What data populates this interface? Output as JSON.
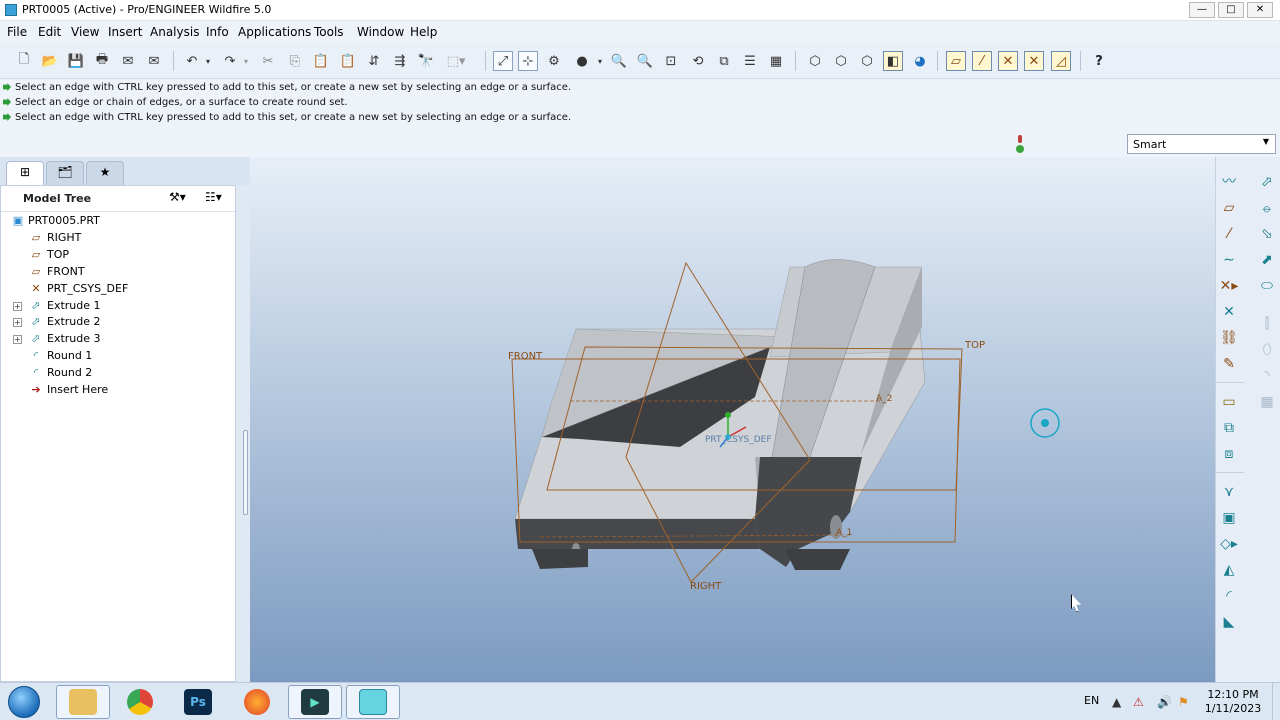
{
  "window": {
    "title": "PRT0005 (Active) - Pro/ENGINEER Wildfire 5.0",
    "controls": {
      "minimize": "—",
      "maximize": "□",
      "close": "✕"
    }
  },
  "menu": [
    "File",
    "Edit",
    "View",
    "Insert",
    "Analysis",
    "Info",
    "Applications",
    "Tools",
    "Window",
    "Help"
  ],
  "toolbar": {
    "icons": [
      "new-icon",
      "open-icon",
      "save-icon",
      "print-icon",
      "send-mail-icon",
      "mail-browser-icon",
      "undo-icon",
      "redo-icon",
      "cut-icon",
      "copy-icon",
      "paste-icon",
      "paste-special-icon",
      "regenerate-icon",
      "regen-manager-icon",
      "find-icon",
      "select-box-icon",
      "repaint-icon",
      "spin-center-icon",
      "orient-icon",
      "appearance-icon",
      "zoom-in-icon",
      "zoom-out-icon",
      "refit-icon",
      "reorient-icon",
      "saved-views-icon",
      "layers-icon",
      "view-manager-icon",
      "wireframe-icon",
      "hidden-line-icon",
      "no-hidden-icon",
      "shading-icon",
      "enhanced-realism-icon",
      "datum-planes-icon",
      "datum-axes-icon",
      "datum-points-icon",
      "csys-icon",
      "annotations-icon",
      "help-icon"
    ]
  },
  "messages": [
    "Select an edge with CTRL key pressed to add to this set, or create a new set by selecting an edge or a surface.",
    "Select an edge or chain of edges, or a surface to create round set.",
    "Select an edge with CTRL key pressed to add to this set, or create a new set by selecting an edge or a surface."
  ],
  "filter": {
    "selected": "Smart"
  },
  "navigator": {
    "tabs": [
      "model-tree-tab",
      "folder-browser-tab",
      "favorites-tab"
    ],
    "title": "Model Tree",
    "settings_icon": "tree-settings-icon",
    "show_icon": "show-icon"
  },
  "tree": [
    {
      "label": "PRT0005.PRT",
      "icon": "part-icon",
      "level": 0,
      "expandable": false
    },
    {
      "label": "RIGHT",
      "icon": "datum-plane-icon",
      "level": 1,
      "expandable": false
    },
    {
      "label": "TOP",
      "icon": "datum-plane-icon",
      "level": 1,
      "expandable": false
    },
    {
      "label": "FRONT",
      "icon": "datum-plane-icon",
      "level": 1,
      "expandable": false
    },
    {
      "label": "PRT_CSYS_DEF",
      "icon": "csys-icon",
      "level": 1,
      "expandable": false
    },
    {
      "label": "Extrude 1",
      "icon": "extrude-icon",
      "level": 1,
      "expandable": true
    },
    {
      "label": "Extrude 2",
      "icon": "extrude-icon",
      "level": 1,
      "expandable": true
    },
    {
      "label": "Extrude 3",
      "icon": "extrude-icon",
      "level": 1,
      "expandable": true
    },
    {
      "label": "Round 1",
      "icon": "round-icon",
      "level": 1,
      "expandable": false
    },
    {
      "label": "Round 2",
      "icon": "round-icon",
      "level": 1,
      "expandable": false
    },
    {
      "label": "Insert Here",
      "icon": "insert-arrow-icon",
      "level": 1,
      "expandable": false
    }
  ],
  "viewport": {
    "datum_labels": {
      "front": "FRONT",
      "top": "TOP",
      "right": "RIGHT",
      "csys": "PRT_CSYS_DEF",
      "axis_2": "A_2",
      "axis_1": "A_1"
    },
    "colors": {
      "datum": "#a0622a",
      "model_light": "#cfd3d8",
      "model_dark": "#4a4c50",
      "spin_center": "#19a6c4"
    }
  },
  "right_toolbar": {
    "icons": [
      "sketch-curve-icon",
      "datum-plane-tool-icon",
      "datum-axis-tool-icon",
      "datum-curve-icon",
      "datum-point-icon",
      "csys-tool-icon",
      "analysis-tool-icon",
      "sketch-tool-icon",
      "copy-paste-icon",
      "mirror-icon",
      "extrude-tool-icon",
      "revolve-tool-icon",
      "variable-sweep-icon",
      "boundary-blend-icon",
      "style-icon",
      "hole-icon",
      "shell-icon",
      "rib-icon",
      "draft-icon",
      "round-tool-icon",
      "chamfer-icon",
      "pattern-icon",
      "merge-icon",
      "trim-icon",
      "offset-icon",
      "thicken-icon",
      "solidify-icon"
    ]
  },
  "taskbar": {
    "apps": [
      "windows-explorer",
      "chrome",
      "photoshop",
      "firefox",
      "filmora",
      "proe"
    ],
    "language": "EN",
    "time": "12:10 PM",
    "date": "1/11/2023"
  }
}
